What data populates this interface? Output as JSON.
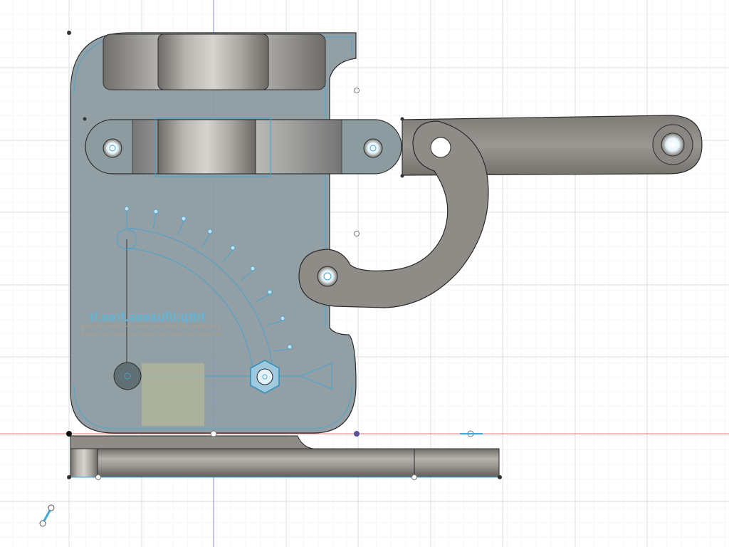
{
  "viewport": {
    "background": "#ffffff",
    "grid_minor": "#eef0f2",
    "grid_major": "#dadde1",
    "axis_x_color": "#e07a7a",
    "axis_y_color": "#8a8ad8"
  },
  "model": {
    "engraved_text": "http://fusees.free.fr",
    "body_fill": "#8c9ba0",
    "metal_fill": "#8f8c87",
    "highlight_color": "#3fa6d6"
  },
  "triad_icon": "axis-triad-icon"
}
